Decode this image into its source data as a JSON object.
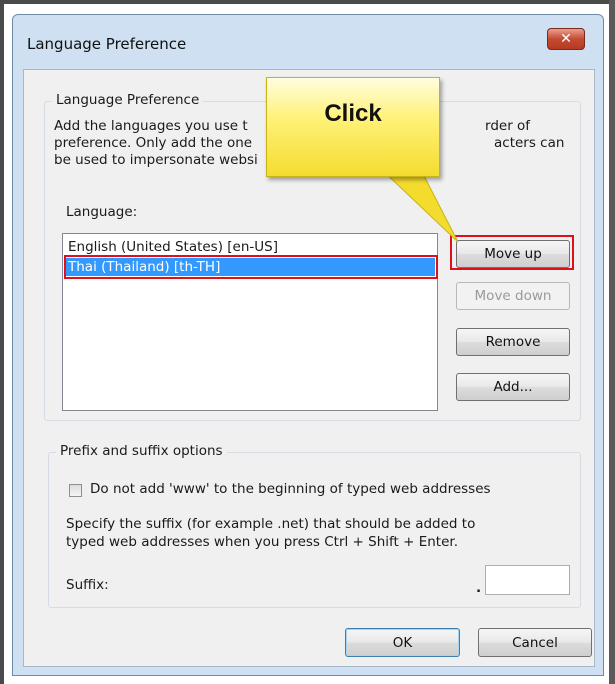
{
  "window": {
    "title": "Language Preference",
    "close_glyph": "✕"
  },
  "language_group": {
    "legend": "Language Preference",
    "description": "Add the languages you use to read websites, listing in order of preference. Only add the ones you need, as some characters can be used to impersonate websites in other languages.",
    "visible_description_lines": [
      "Add the languages you use t",
      "rder of",
      "preference. Only add the one",
      "acters can",
      "be used to impersonate websi"
    ],
    "list_label": "Language:",
    "languages": [
      {
        "label": "English (United States) [en-US]",
        "selected": false
      },
      {
        "label": "Thai (Thailand) [th-TH]",
        "selected": true
      }
    ],
    "buttons": {
      "move_up": "Move up",
      "move_down": "Move down",
      "remove": "Remove",
      "add": "Add..."
    }
  },
  "prefix_group": {
    "legend": "Prefix and suffix options",
    "checkbox_label": "Do not add 'www' to the beginning of typed web addresses",
    "checkbox_checked": false,
    "suffix_desc_line1": "Specify the suffix (for example .net) that should be added to",
    "suffix_desc_line2": "typed web addresses when you press Ctrl + Shift + Enter.",
    "suffix_label": "Suffix:",
    "suffix_dot": ".",
    "suffix_value": ""
  },
  "footer": {
    "ok": "OK",
    "cancel": "Cancel"
  },
  "annotation": {
    "callout_text": "Click",
    "highlight_color": "#e0101a",
    "callout_color": "#fff27a"
  },
  "colors": {
    "selection": "#3399ff",
    "dialog_frame": "#cfe0f2",
    "client": "#f0f0f0"
  }
}
